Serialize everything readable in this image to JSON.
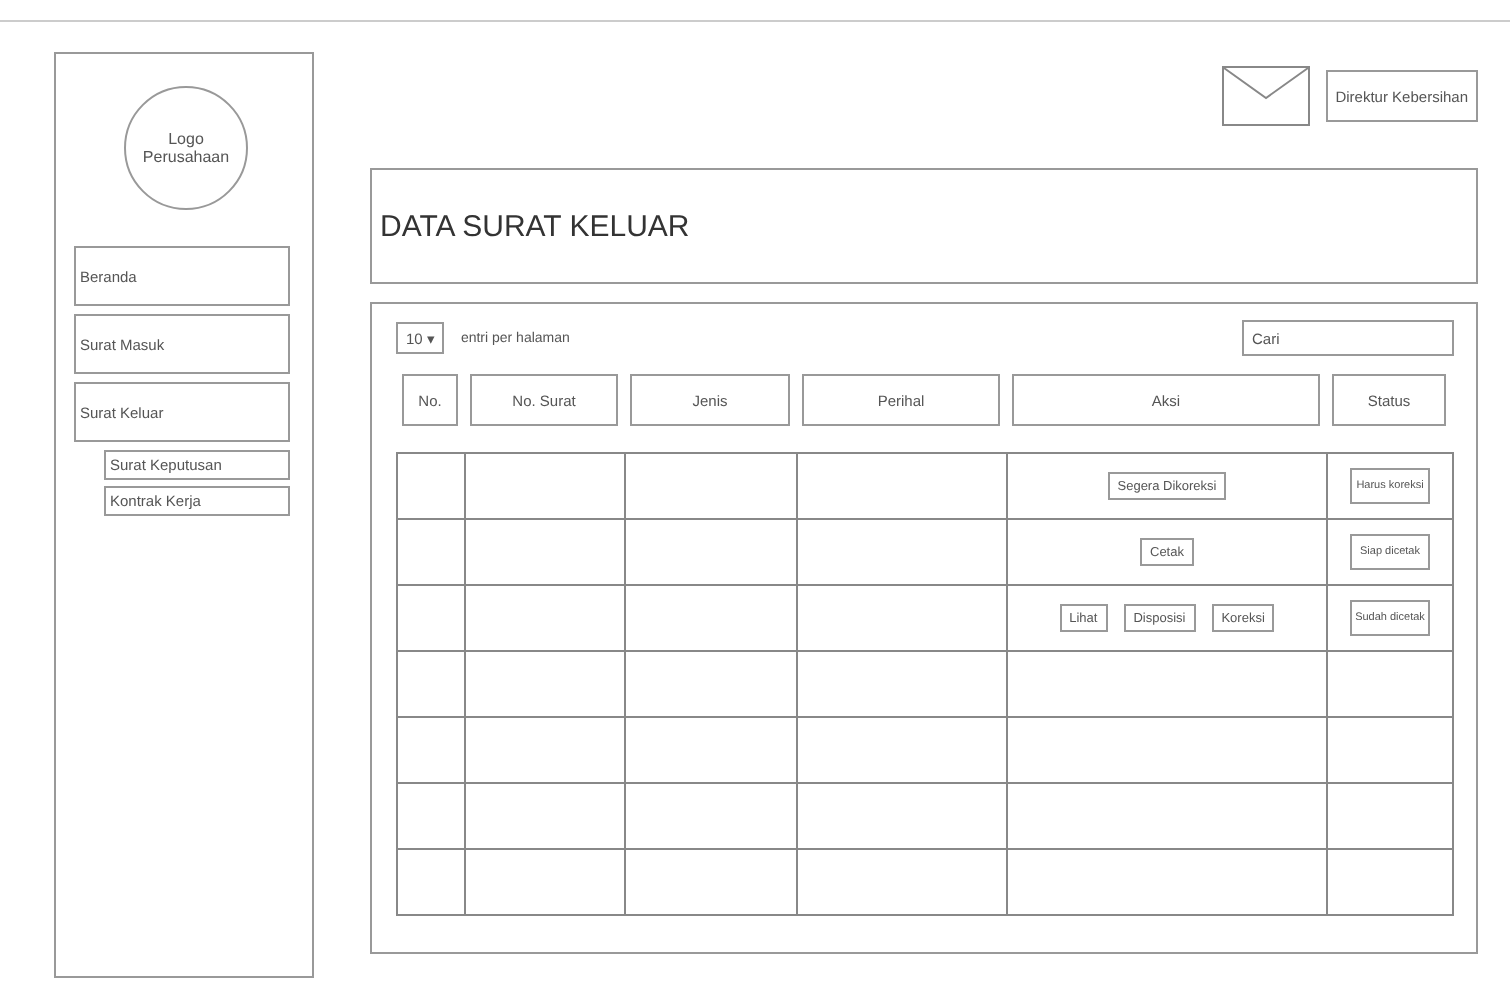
{
  "sidebar": {
    "logo": "Logo Perusahaan",
    "items": [
      {
        "label": "Beranda"
      },
      {
        "label": "Surat Masuk"
      },
      {
        "label": "Surat Keluar",
        "children": [
          {
            "label": "Surat Keputusan"
          },
          {
            "label": "Kontrak Kerja"
          }
        ]
      }
    ]
  },
  "header": {
    "user": "Direktur Kebersihan"
  },
  "title": "DATA SURAT KELUAR",
  "table": {
    "page_size": "10 ▾",
    "page_size_label": "entri per halaman",
    "search": {
      "placeholder": "Cari"
    },
    "columns": [
      "No.",
      "No. Surat",
      "Jenis",
      "Perihal",
      "Aksi",
      "Status"
    ],
    "rows": [
      {
        "actions": [
          "Segera Dikoreksi"
        ],
        "status": "Harus koreksi"
      },
      {
        "actions": [
          "Cetak"
        ],
        "status": "Siap dicetak"
      },
      {
        "actions": [
          "Lihat",
          "Disposisi",
          "Koreksi"
        ],
        "status": "Sudah dicetak"
      },
      {},
      {},
      {},
      {}
    ]
  }
}
